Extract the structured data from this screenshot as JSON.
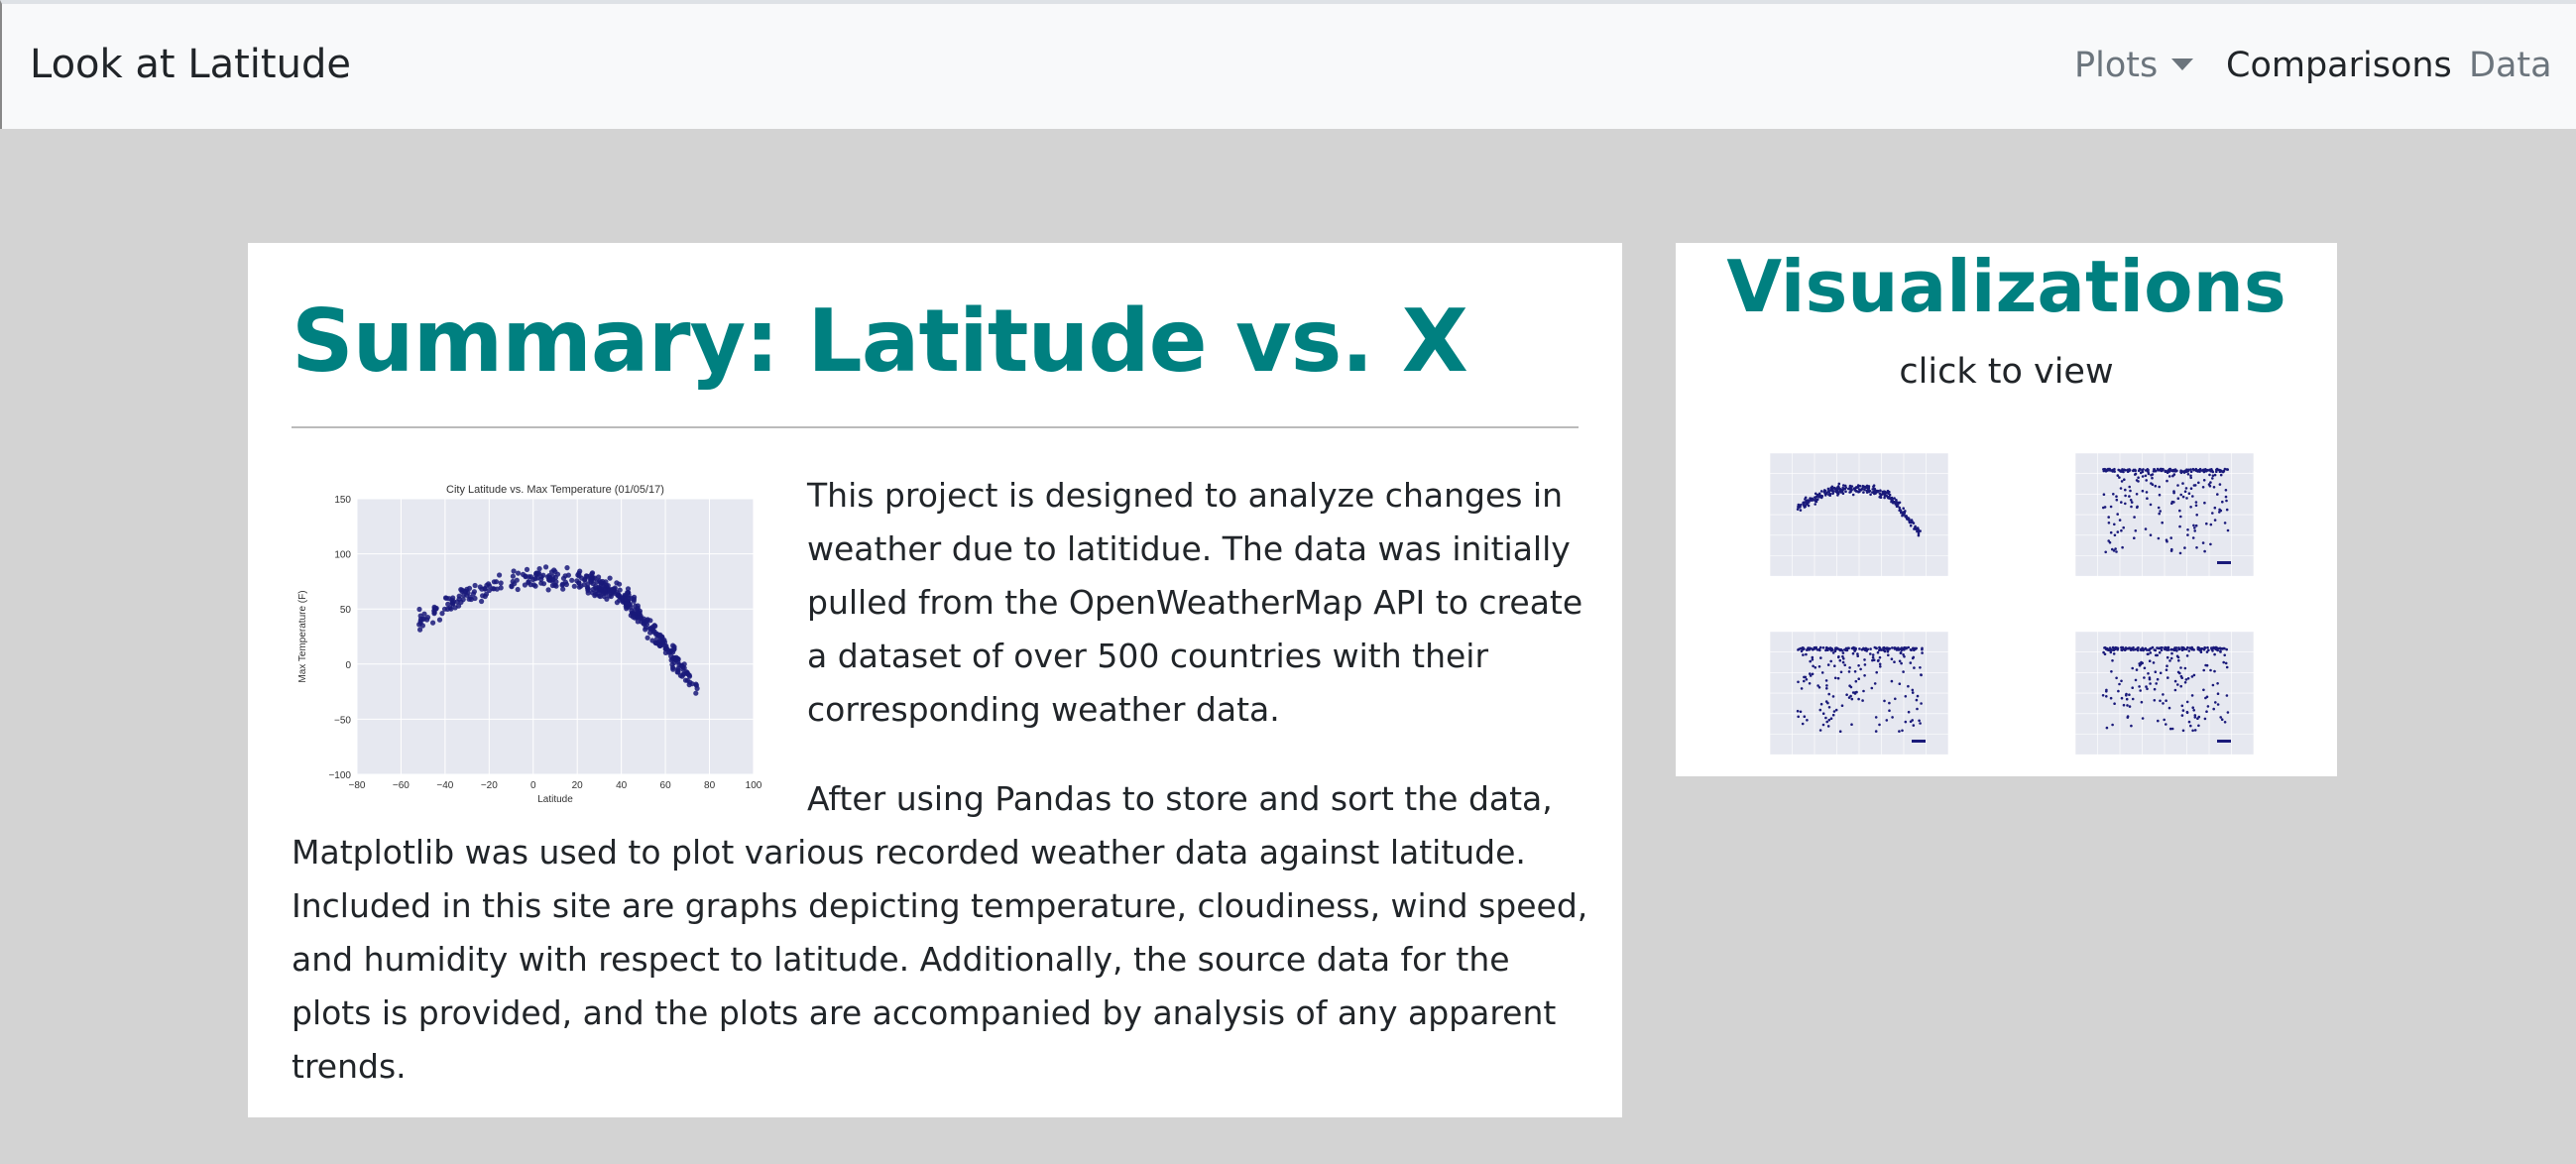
{
  "navbar": {
    "brand": "Look at Latitude",
    "items": [
      {
        "label": "Plots",
        "dropdown": true
      },
      {
        "label": "Comparisons"
      },
      {
        "label": "Data"
      }
    ]
  },
  "summary": {
    "title": "Summary: Latitude vs. X",
    "paragraph_1": "This project is designed to analyze changes in weather due to latitidue. The data was initially pulled from the OpenWeatherMap API to create a dataset of over 500 countries with their corresponding weather data.",
    "paragraph_2": "After using Pandas to store and sort the data, Matplotlib was used to plot various recorded weather data against latitude. Included in this site are graphs depicting temperature, cloudiness, wind speed, and humidity with respect to latitude. Additionally, the source data for the plots is provided, and the plots are accompanied by analysis of any apparent trends.",
    "figure": {
      "title": "City Latitude vs. Max Temperature (01/05/17)",
      "xlabel": "Latitude",
      "ylabel": "Max Temperature (F)",
      "xticks": [
        "−80",
        "−60",
        "−40",
        "−20",
        "0",
        "20",
        "40",
        "60",
        "80",
        "100"
      ],
      "yticks": [
        "150",
        "100",
        "50",
        "0",
        "−50",
        "−100"
      ]
    }
  },
  "visualizations": {
    "title": "Visualizations",
    "subtitle": "click to view"
  },
  "colors": {
    "accent": "#008080",
    "page_background": "#d3d3d3",
    "navbar_background": "#f8f9fa",
    "scatter_point": "#1a1a7a",
    "plot_background": "#e6e8f0"
  }
}
